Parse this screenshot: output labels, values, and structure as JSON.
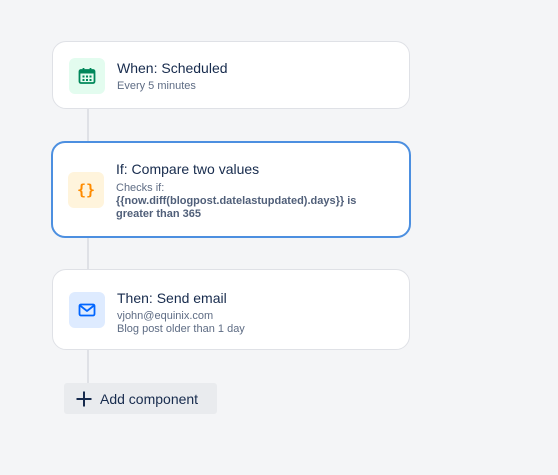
{
  "steps": [
    {
      "kind": "trigger",
      "title": "When: Scheduled",
      "subtitle": "Every 5 minutes",
      "icon": "calendar-icon",
      "icon_color": "#00875a",
      "icon_bg": "#e3fcef"
    },
    {
      "kind": "condition",
      "title": "If: Compare two values",
      "lines": [
        "Checks if:",
        "{{now.diff(blogpost.datelastupdated).days}} is greater than 365"
      ],
      "icon": "curly-braces-icon",
      "icon_color": "#ff8b00",
      "icon_bg": "#fff4dc",
      "selected": true
    },
    {
      "kind": "action",
      "title": "Then: Send email",
      "lines": [
        "vjohn@equinix.com",
        "Blog post older than 1 day"
      ],
      "icon": "envelope-icon",
      "icon_color": "#0065ff",
      "icon_bg": "#deebff"
    }
  ],
  "add_component": {
    "label": "Add component",
    "icon": "plus-icon"
  },
  "colors": {
    "selected_border": "#4c8fe0",
    "connector": "#dfe1e6",
    "background": "#f4f5f7"
  }
}
